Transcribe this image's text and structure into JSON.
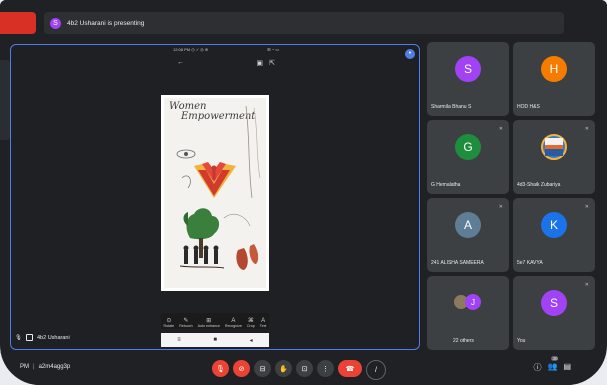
{
  "presenting_banner": {
    "avatar_letter": "S",
    "text": "4b2 Usharani is presenting"
  },
  "stage": {
    "presenter_name": "4b2 Usharani",
    "pin_icon": "more-icon",
    "phone_status": {
      "left": "12:08 PM ◷ ✓ ◎ ⊕",
      "right": "⊞ ◔ ▭"
    },
    "phone_toolbar": {
      "back_icon": "←",
      "action1_icon": "▣",
      "action2_icon": "⇱"
    },
    "poster_title_line1": "Women",
    "poster_title_line2": "Empowerment",
    "photo_tools": [
      {
        "icon": "⊙",
        "label": "Rotate"
      },
      {
        "icon": "✎",
        "label": "Retouch"
      },
      {
        "icon": "⊞",
        "label": "Auto enhance"
      },
      {
        "icon": "A",
        "label": "Recognize"
      },
      {
        "icon": "⌘",
        "label": "Crop"
      },
      {
        "icon": "A",
        "label": "Text"
      }
    ],
    "android_nav": [
      "≡",
      "■",
      "◂"
    ]
  },
  "participants": [
    {
      "name": "Sharmila Bhanu S",
      "letter": "S",
      "color": "#a142f4",
      "muted": false
    },
    {
      "name": "HOD H&S",
      "letter": "H",
      "color": "#f57c00",
      "muted": false
    },
    {
      "name": "G Hemalatha",
      "letter": "G",
      "color": "#1e8e3e",
      "muted": true
    },
    {
      "name": "4d3-Shaik Zubariya",
      "letter": "",
      "color": "#3b78c2",
      "muted": true
    },
    {
      "name": "241 ALISHA SAMEERA",
      "letter": "A",
      "color": "#5f7d95",
      "muted": true
    },
    {
      "name": "5e7 KAVYA",
      "letter": "K",
      "color": "#1a73e8",
      "muted": true
    },
    {
      "name": "22 others",
      "letter": "J",
      "color": "#a142f4",
      "muted": false
    },
    {
      "name": "You",
      "letter": "S",
      "color": "#a142f4",
      "muted": true
    }
  ],
  "bottom": {
    "time": "PM",
    "separator": "|",
    "meeting_code": "a2m4agg3p",
    "controls": [
      {
        "name": "mic-off-icon",
        "glyph": "🎙",
        "red": true
      },
      {
        "name": "camera-off-icon",
        "glyph": "⊘",
        "red": true
      },
      {
        "name": "captions-icon",
        "glyph": "⊟",
        "red": false
      },
      {
        "name": "raise-hand-icon",
        "glyph": "✋",
        "red": false
      },
      {
        "name": "present-icon",
        "glyph": "⊡",
        "red": false
      },
      {
        "name": "more-options-icon",
        "glyph": "⋮",
        "red": false
      }
    ],
    "end_call_glyph": "☎",
    "right_icons": [
      "ⓘ",
      "👥",
      "▤"
    ],
    "participant_count": "30"
  }
}
